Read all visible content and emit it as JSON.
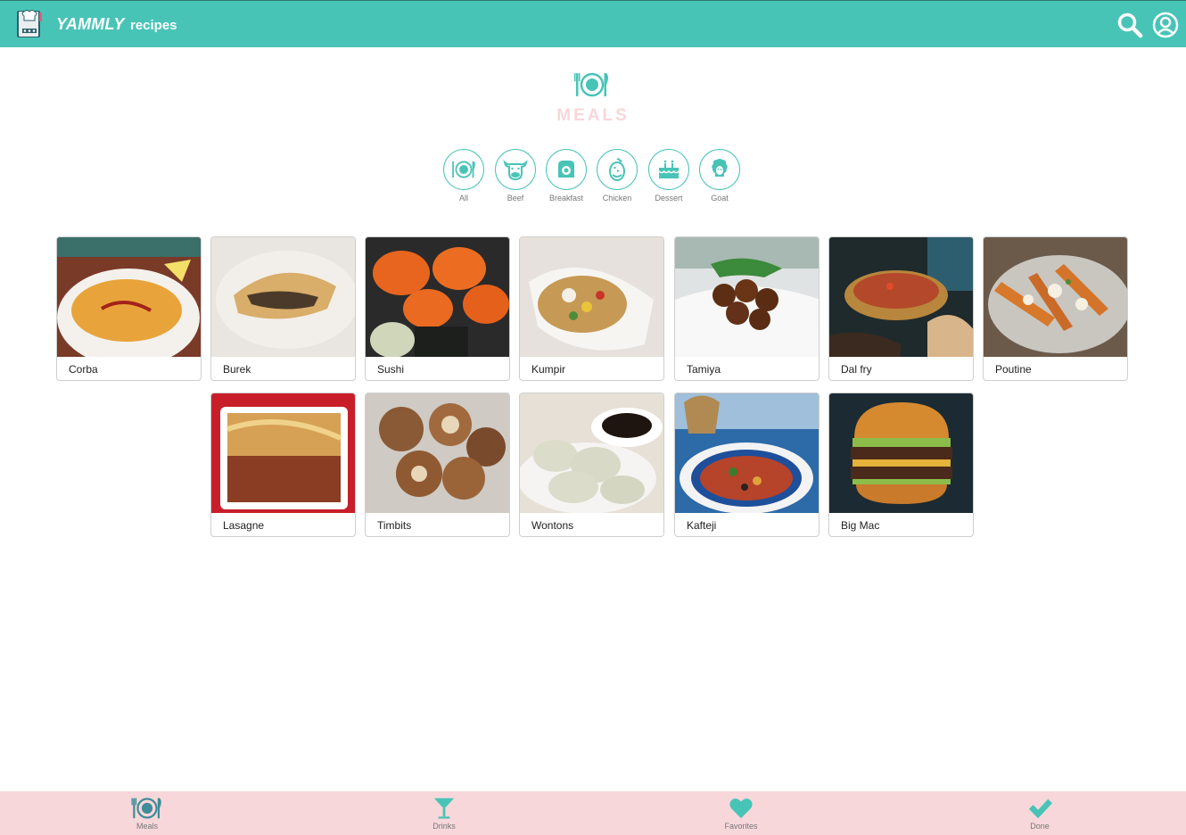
{
  "header": {
    "brand_name": "YAMMLY",
    "brand_sub": "recipes",
    "logo_icon": "chef-hat-book-icon",
    "search_icon": "search-icon",
    "profile_icon": "user-circle-icon"
  },
  "page": {
    "icon": "plate-cutlery-icon",
    "title": "MEALS"
  },
  "categories": [
    {
      "label": "All",
      "icon": "plate-cutlery-icon"
    },
    {
      "label": "Beef",
      "icon": "cow-icon"
    },
    {
      "label": "Breakfast",
      "icon": "toaster-icon"
    },
    {
      "label": "Chicken",
      "icon": "chicken-icon"
    },
    {
      "label": "Dessert",
      "icon": "cake-icon"
    },
    {
      "label": "Goat",
      "icon": "goat-icon"
    }
  ],
  "recipes": [
    {
      "name": "Corba"
    },
    {
      "name": "Burek"
    },
    {
      "name": "Sushi"
    },
    {
      "name": "Kumpir"
    },
    {
      "name": "Tamiya"
    },
    {
      "name": "Dal fry"
    },
    {
      "name": "Poutine"
    },
    {
      "name": "Lasagne"
    },
    {
      "name": "Timbits"
    },
    {
      "name": "Wontons"
    },
    {
      "name": "Kafteji"
    },
    {
      "name": "Big Mac"
    }
  ],
  "nav": [
    {
      "label": "Meals",
      "icon": "plate-cutlery-icon"
    },
    {
      "label": "Drinks",
      "icon": "cocktail-icon"
    },
    {
      "label": "Favorites",
      "icon": "heart-icon"
    },
    {
      "label": "Done",
      "icon": "check-icon"
    }
  ],
  "colors": {
    "primary": "#48c4b7",
    "accent_pink": "#f7d7da",
    "meal_icon": "#3f8d98",
    "text_muted": "#777777"
  }
}
